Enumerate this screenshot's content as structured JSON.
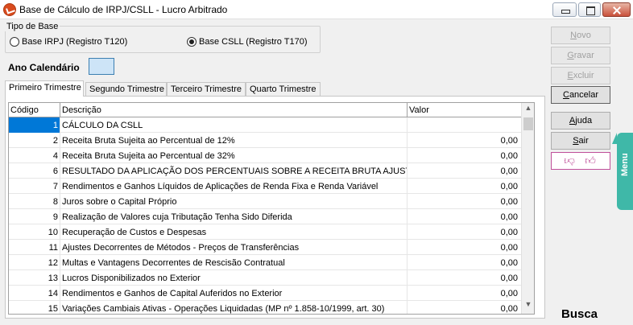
{
  "window": {
    "title": "Base de Cálculo de IRPJ/CSLL - Lucro Arbitrado"
  },
  "tipo_base": {
    "label": "Tipo de Base",
    "options": [
      {
        "label": "Base IRPJ (Registro T120)",
        "selected": false
      },
      {
        "label": "Base CSLL (Registro T170)",
        "selected": true
      }
    ]
  },
  "ano": {
    "label": "Ano Calendário",
    "value": ""
  },
  "tabs": [
    {
      "label": "Primeiro Trimestre",
      "active": true
    },
    {
      "label": "Segundo Trimestre",
      "active": false
    },
    {
      "label": "Terceiro Trimestre",
      "active": false
    },
    {
      "label": "Quarto Trimestre",
      "active": false
    }
  ],
  "grid": {
    "headers": {
      "code": "Código",
      "desc": "Descrição",
      "value": "Valor"
    },
    "rows": [
      {
        "code": "1",
        "desc": "CÁLCULO DA CSLL",
        "value": ""
      },
      {
        "code": "2",
        "desc": "Receita Bruta Sujeita ao Percentual de 12%",
        "value": "0,00"
      },
      {
        "code": "4",
        "desc": "Receita Bruta Sujeita ao Percentual de 32%",
        "value": "0,00"
      },
      {
        "code": "6",
        "desc": "RESULTADO DA APLICAÇÃO DOS PERCENTUAIS SOBRE A RECEITA BRUTA AJUSTADO",
        "value": "0,00"
      },
      {
        "code": "7",
        "desc": "Rendimentos e Ganhos Líquidos de Aplicações de Renda Fixa e Renda Variável",
        "value": "0,00"
      },
      {
        "code": "8",
        "desc": "Juros sobre o Capital Próprio",
        "value": "0,00"
      },
      {
        "code": "9",
        "desc": "Realização de Valores cuja Tributação Tenha Sido Diferida",
        "value": "0,00"
      },
      {
        "code": "10",
        "desc": "Recuperação de Custos e Despesas",
        "value": "0,00"
      },
      {
        "code": "11",
        "desc": "Ajustes Decorrentes de Métodos - Preços de Transferências",
        "value": "0,00"
      },
      {
        "code": "12",
        "desc": "Multas e Vantagens Decorrentes de Rescisão Contratual",
        "value": "0,00"
      },
      {
        "code": "13",
        "desc": "Lucros Disponibilizados no Exterior",
        "value": "0,00"
      },
      {
        "code": "14",
        "desc": "Rendimentos e Ganhos de Capital Auferidos no Exterior",
        "value": "0,00"
      },
      {
        "code": "15",
        "desc": "Variações Cambiais Ativas - Operações Liquidadas (MP nº 1.858-10/1999, art. 30)",
        "value": "0,00"
      }
    ]
  },
  "buttons": {
    "novo": "Novo",
    "gravar": "Gravar",
    "excluir": "Excluir",
    "cancelar": "Cancelar",
    "ajuda": "Ajuda",
    "sair": "Sair"
  },
  "side_menu": "Menu",
  "busca": "Busca",
  "colors": {
    "selection": "#0078d7",
    "menu_tab": "#3fb8a8",
    "feedback": "#c0509a"
  }
}
